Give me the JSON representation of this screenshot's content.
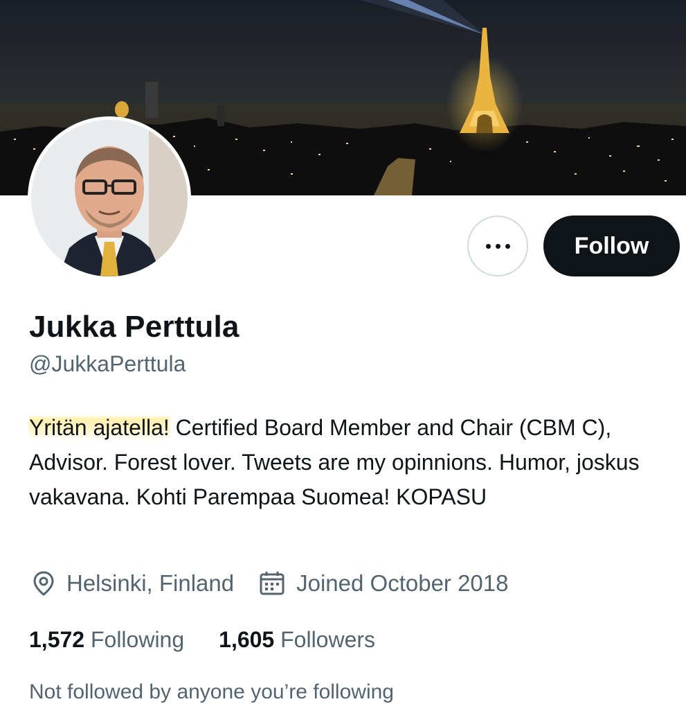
{
  "banner": {
    "alt": "Night view of Paris with the illuminated Eiffel Tower"
  },
  "avatar": {
    "alt": "Profile photo of Jukka Perttula"
  },
  "actions": {
    "follow_label": "Follow"
  },
  "profile": {
    "name": "Jukka Perttula",
    "handle": "@JukkaPerttula",
    "bio_highlight": "Yritän ajatella!",
    "bio_rest": " Certified Board Member and Chair (CBM C), Advisor. Forest lover. Tweets are my opinnions. Humor, joskus vakavana. Kohti Parempaa Suomea! KOPASU",
    "location": "Helsinki, Finland",
    "joined": "Joined October 2018",
    "location_icon": "location-pin-icon",
    "joined_icon": "calendar-icon"
  },
  "stats": {
    "following_count": "1,572",
    "following_label": "Following",
    "followers_count": "1,605",
    "followers_label": "Followers"
  },
  "footer": {
    "not_followed": "Not followed by anyone you’re following"
  },
  "colors": {
    "primary_text": "#0f1419",
    "secondary_text": "#536471",
    "follow_bg": "#0f1419",
    "highlight": "#fde98e"
  }
}
